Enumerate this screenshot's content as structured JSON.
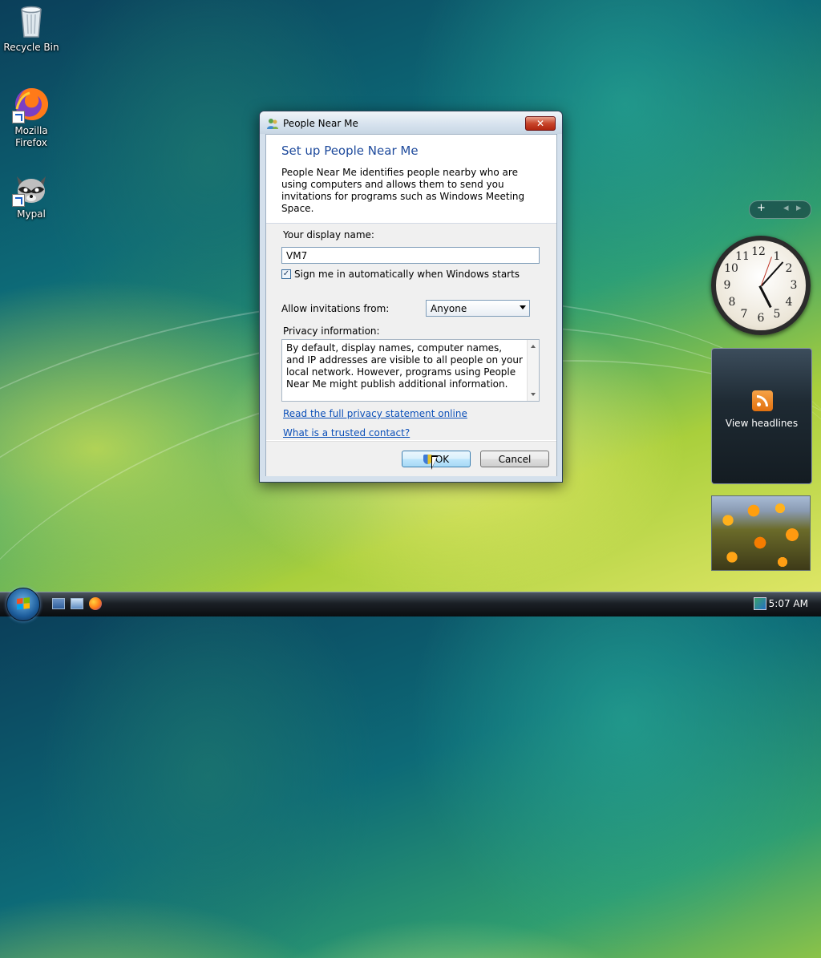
{
  "desktop": {
    "icons": [
      {
        "label": "Recycle Bin",
        "icon": "recycle-bin-icon"
      },
      {
        "label": "Mozilla Firefox",
        "icon": "firefox-icon"
      },
      {
        "label": "Mypal",
        "icon": "mypal-icon"
      }
    ]
  },
  "dialog": {
    "title": "People Near Me",
    "close_label": "✕",
    "heading": "Set up People Near Me",
    "intro": "People Near Me identifies people nearby who are using computers and allows them to send you invitations for programs such as Windows Meeting Space.",
    "display_name_label": "Your display name:",
    "display_name_value": "VM7",
    "auto_sign_in_label": "Sign me in automatically when Windows starts",
    "auto_sign_in_checked": true,
    "check_mark": "✓",
    "allow_invitations_label": "Allow invitations from:",
    "allow_invitations_value": "Anyone",
    "privacy_label": "Privacy information:",
    "privacy_text": "By default, display names, computer names, and IP addresses are visible to all people on your local network. However, programs using People Near Me might publish additional information.",
    "link_privacy": "Read the full privacy statement online",
    "link_trusted": "What is a trusted contact?",
    "ok_label": "OK",
    "cancel_label": "Cancel"
  },
  "sidebar": {
    "add_label": "+",
    "prev_label": "◂",
    "next_label": "▸",
    "clock_numbers": [
      "12",
      "1",
      "2",
      "3",
      "4",
      "5",
      "6",
      "7",
      "8",
      "9",
      "10",
      "11"
    ],
    "clock_time": "5:07",
    "feed_label": "View headlines",
    "photo": "orange-flowers-photo"
  },
  "taskbar": {
    "time": "5:07 AM"
  },
  "colors": {
    "heading": "#1e4a9c",
    "link": "#0b4fb8",
    "close_button": "#c8452b"
  }
}
